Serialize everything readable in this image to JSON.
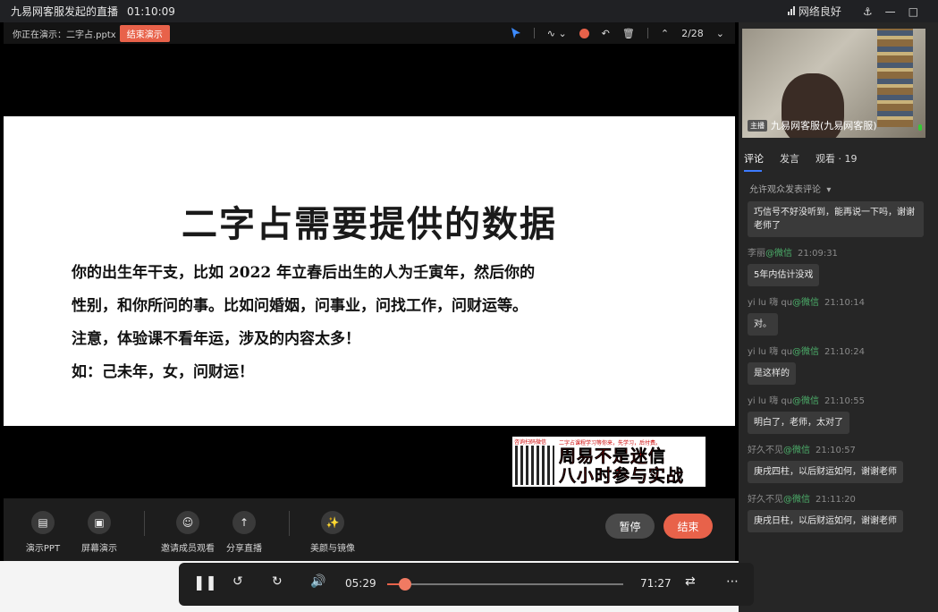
{
  "titlebar": {
    "title": "九易网客服发起的直播",
    "timer": "01:10:09",
    "network": "网络良好"
  },
  "presenter": {
    "label": "你正在演示：二字占.pptx",
    "end_label": "结束演示",
    "page": "2/28",
    "rec_color": "#e8624a"
  },
  "slide": {
    "title": "二字占需要提供的数据",
    "lines": [
      "你的出生年干支，比如 2022 年立春后出生的人为壬寅年，然后你的",
      "性别，和你所问的事。比如问婚姻，问事业，问找工作，问财运等。",
      "注意，体验课不看年运，涉及的内容太多！",
      "如：己未年，女，问财运！"
    ]
  },
  "ad": {
    "qr_caption": "咨询扫码微信",
    "small": "二字占课程学习等你来，先学习，后付费。",
    "line1": "周易不是迷信",
    "line2": "八小时参与实战"
  },
  "toolbar": {
    "items": [
      {
        "label": "演示PPT",
        "icon": "ppt-icon"
      },
      {
        "label": "屏幕演示",
        "icon": "screen-share-icon"
      },
      {
        "label": "邀请成员观看",
        "icon": "invite-icon"
      },
      {
        "label": "分享直播",
        "icon": "share-icon"
      },
      {
        "label": "美颜与镜像",
        "icon": "beauty-icon"
      }
    ],
    "pause_label": "暂停",
    "end_label": "结束"
  },
  "camera": {
    "role": "主播",
    "name": "九易网客服(九易网客服)"
  },
  "tabs": {
    "comments": "评论",
    "speak": "发言",
    "viewers": "观看 · 19"
  },
  "filter_label": "允许观众发表评论",
  "chat": {
    "first_bubble": "巧信号不好没听到，能再说一下吗，谢谢老师了",
    "messages": [
      {
        "user": "李丽",
        "src": "@微信",
        "time": "21:09:31",
        "text": "5年内估计没戏"
      },
      {
        "user": "yi lu 嗨 qu",
        "src": "@微信",
        "time": "21:10:14",
        "text": "对。"
      },
      {
        "user": "yi lu 嗨 qu",
        "src": "@微信",
        "time": "21:10:24",
        "text": "是这样的"
      },
      {
        "user": "yi lu 嗨 qu",
        "src": "@微信",
        "time": "21:10:55",
        "text": "明白了，老师，太对了"
      },
      {
        "user": "好久不见",
        "src": "@微信",
        "time": "21:10:57",
        "text": "庚戌四柱，以后财运如何，谢谢老师"
      },
      {
        "user": "好久不见",
        "src": "@微信",
        "time": "21:11:20",
        "text": "庚戌日柱，以后财运如何，谢谢老师"
      }
    ]
  },
  "player": {
    "current": "05:29",
    "total": "71:27",
    "progress": 0.077,
    "accent": "#e8624a"
  }
}
